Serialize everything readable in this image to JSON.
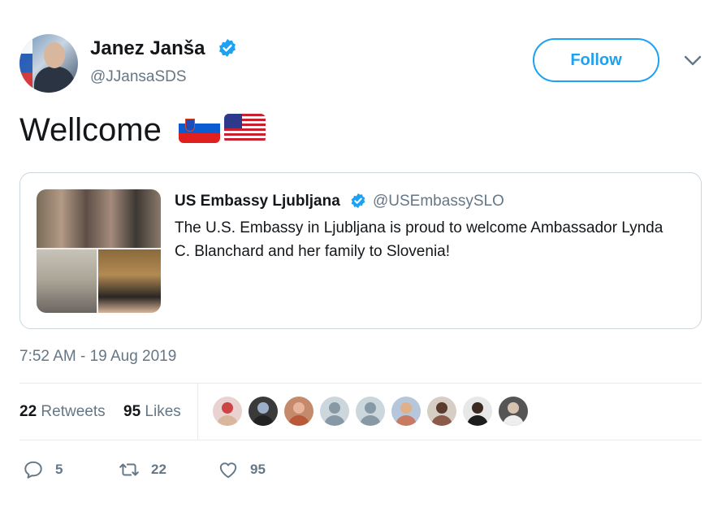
{
  "author": {
    "display_name": "Janez Janša",
    "handle": "@JJansaSDS",
    "verified": true
  },
  "follow_label": "Follow",
  "tweet": {
    "text": "Wellcome",
    "flags": [
      "slovenia-flag",
      "usa-flag"
    ]
  },
  "quoted_tweet": {
    "display_name": "US Embassy Ljubljana",
    "handle": "@USEmbassySLO",
    "verified": true,
    "text": "The U.S. Embassy in Ljubljana is proud to welcome Ambassador Lynda C. Blanchard and her family to Slovenia!"
  },
  "timestamp": "7:52 AM - 19 Aug 2019",
  "stats": {
    "retweets_count": "22",
    "retweets_label": "Retweets",
    "likes_count": "95",
    "likes_label": "Likes"
  },
  "liker_avatar_count": 9,
  "actions": {
    "reply_count": "5",
    "retweet_count": "22",
    "like_count": "95"
  },
  "colors": {
    "accent": "#1da1f2",
    "secondary_text": "#657786",
    "primary_text": "#14171a",
    "border": "#ccd6dd"
  }
}
